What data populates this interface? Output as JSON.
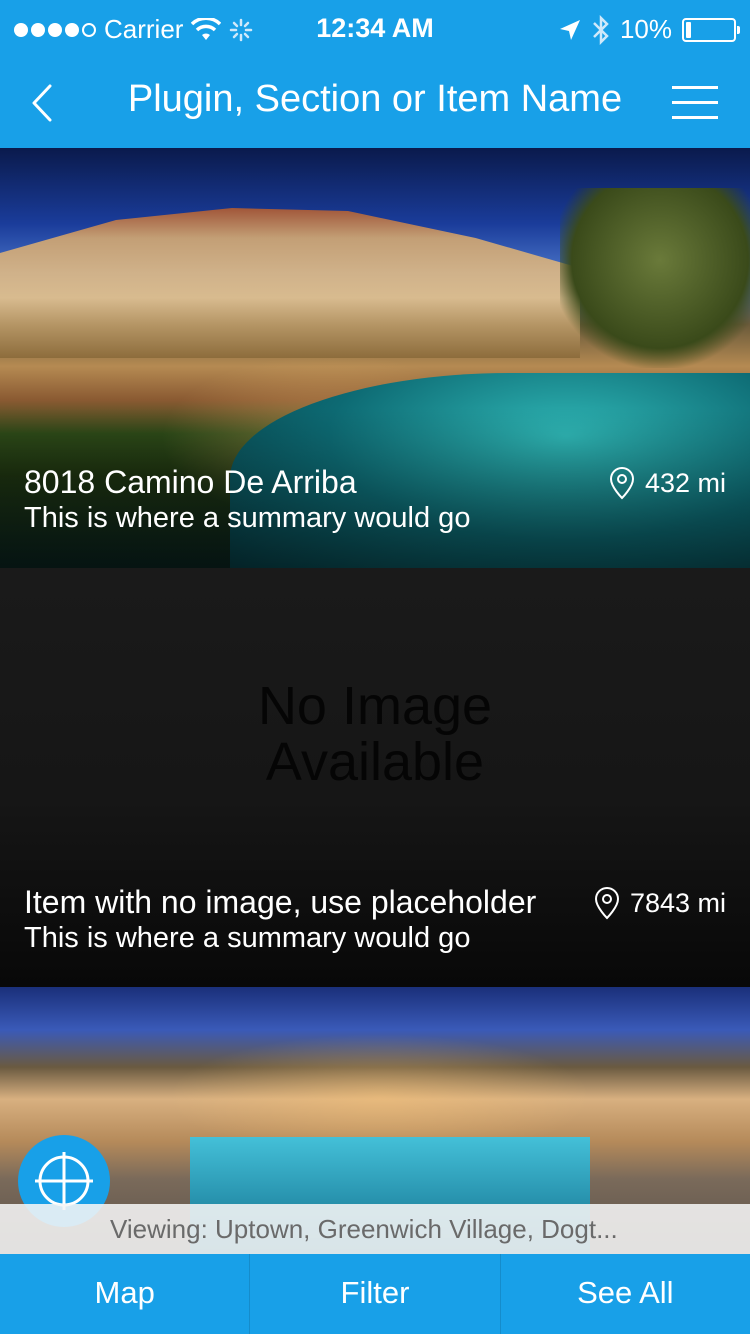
{
  "status_bar": {
    "carrier": "Carrier",
    "time": "12:34 AM",
    "battery": "10%",
    "battery_level": 0.1
  },
  "nav": {
    "title": "Plugin, Section or Item Name",
    "back_icon": "chevron-left-icon",
    "menu_icon": "hamburger-menu-icon"
  },
  "items": [
    {
      "title": "8018 Camino De Arriba",
      "summary": "This is where a summary would go",
      "distance": "432 mi"
    },
    {
      "title": "Item with no image, use placeholder",
      "summary": "This is where a summary would go",
      "distance": "7843 mi",
      "placeholder_line1": "No Image",
      "placeholder_line2": "Available"
    }
  ],
  "viewing": "Viewing: Uptown, Greenwich Village, Dogt...",
  "tabs": [
    {
      "label": "Map"
    },
    {
      "label": "Filter"
    },
    {
      "label": "See All"
    }
  ],
  "colors": {
    "accent": "#18a0e8"
  }
}
